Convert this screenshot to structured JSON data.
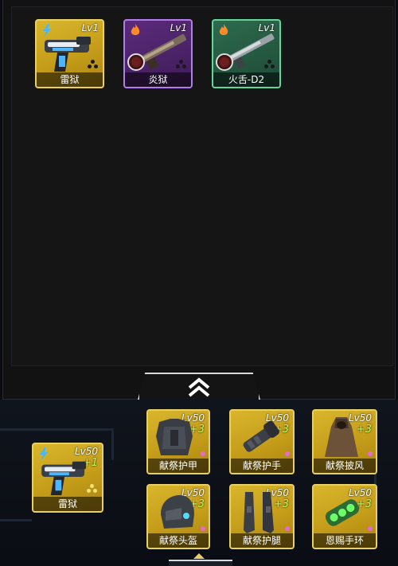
{
  "weapons": [
    {
      "name": "雷狱",
      "level": "Lv1",
      "element": "lightning",
      "rarity": "gold"
    },
    {
      "name": "炎狱",
      "level": "Lv1",
      "element": "fire",
      "rarity": "purple"
    },
    {
      "name": "火舌-D2",
      "level": "Lv1",
      "element": "fire",
      "rarity": "green"
    }
  ],
  "equipped_weapon": {
    "name": "雷狱",
    "level": "Lv50",
    "plus": "+1",
    "element": "lightning"
  },
  "equipment": [
    {
      "name": "献祭护甲",
      "level": "Lv50",
      "plus": "+3",
      "icon": "armor-icon"
    },
    {
      "name": "献祭护手",
      "level": "Lv50",
      "plus": "+3",
      "icon": "gauntlet-icon"
    },
    {
      "name": "献祭披风",
      "level": "Lv50",
      "plus": "+3",
      "icon": "cloak-icon"
    },
    {
      "name": "献祭头盔",
      "level": "Lv50",
      "plus": "+3",
      "icon": "helmet-icon"
    },
    {
      "name": "献祭护腿",
      "level": "Lv50",
      "plus": "+3",
      "icon": "leg-guard-icon"
    },
    {
      "name": "恩赐手环",
      "level": "Lv50",
      "plus": "+3",
      "icon": "bracelet-icon"
    }
  ],
  "colors": {
    "gold": "#d9b62c",
    "purple": "#5b2b7c",
    "green": "#2d6b4e",
    "plus": "#b9ff5c"
  }
}
